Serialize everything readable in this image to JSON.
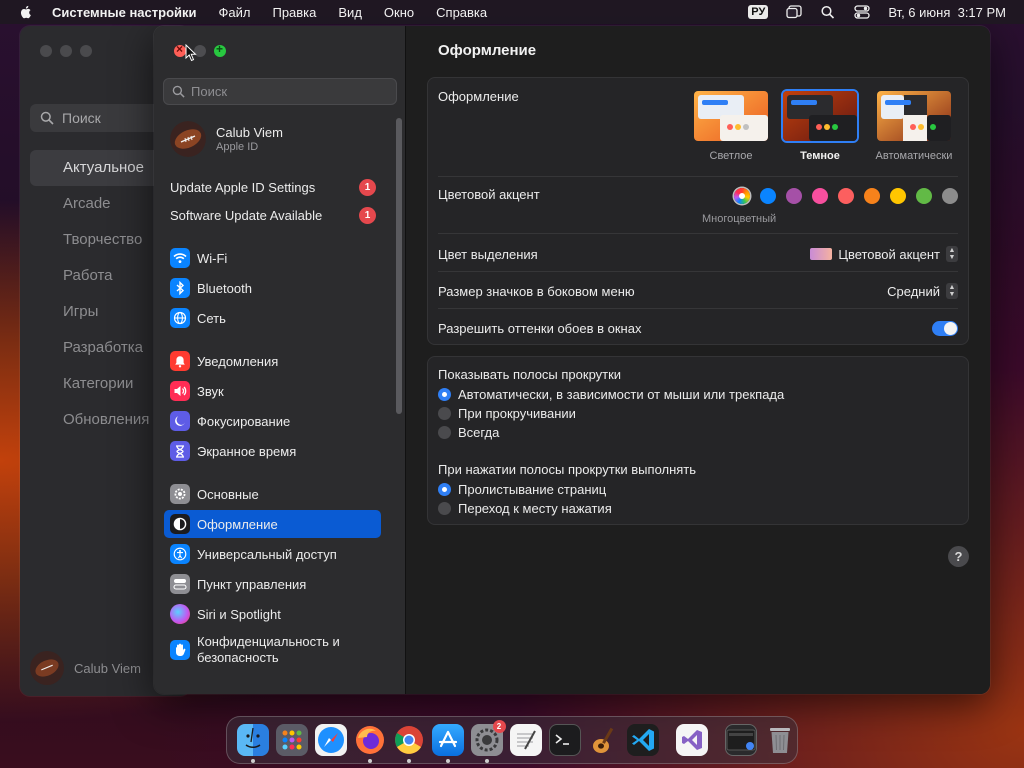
{
  "menubar": {
    "app_name": "Системные настройки",
    "menus": [
      "Файл",
      "Правка",
      "Вид",
      "Окно",
      "Справка"
    ],
    "input_lang": "РУ",
    "datetime": "Вт, 6 июня  3:17 PM"
  },
  "bg_window": {
    "search_placeholder": "Поиск",
    "items": [
      "Актуальное",
      "Arcade",
      "Творчество",
      "Работа",
      "Игры",
      "Разработка",
      "Категории",
      "Обновления"
    ],
    "user_name": "Calub Viem"
  },
  "sidebar": {
    "search_placeholder": "Поиск",
    "profile": {
      "name": "Calub Viem",
      "sub": "Apple ID"
    },
    "notices": [
      {
        "label": "Update Apple ID Settings",
        "badge": "1"
      },
      {
        "label": "Software Update Available",
        "badge": "1"
      }
    ],
    "items": [
      {
        "label": "Wi-Fi",
        "icon": "wifi-icon",
        "color": "#0a84ff"
      },
      {
        "label": "Bluetooth",
        "icon": "bluetooth-icon",
        "color": "#0a84ff"
      },
      {
        "label": "Сеть",
        "icon": "globe-icon",
        "color": "#0a84ff"
      },
      {
        "label": "Уведомления",
        "icon": "bell-icon",
        "color": "#ff3b30"
      },
      {
        "label": "Звук",
        "icon": "speaker-icon",
        "color": "#ff2d55"
      },
      {
        "label": "Фокусирование",
        "icon": "moon-icon",
        "color": "#5e5ce6"
      },
      {
        "label": "Экранное время",
        "icon": "hourglass-icon",
        "color": "#5e5ce6"
      },
      {
        "label": "Основные",
        "icon": "gear-icon",
        "color": "#8e8e93"
      },
      {
        "label": "Оформление",
        "icon": "appearance-icon",
        "color": "#1c1c1e"
      },
      {
        "label": "Универсальный доступ",
        "icon": "accessibility-icon",
        "color": "#0a84ff"
      },
      {
        "label": "Пункт управления",
        "icon": "control-center-icon",
        "color": "#8e8e93"
      },
      {
        "label": "Siri и Spotlight",
        "icon": "siri-icon",
        "color": "#bf5af2"
      },
      {
        "label": "Конфиденциальность и безопасность",
        "icon": "hand-icon",
        "color": "#0a84ff"
      }
    ]
  },
  "content": {
    "title": "Оформление",
    "appearance": {
      "label": "Оформление",
      "options": [
        {
          "label": "Светлое",
          "selected": false
        },
        {
          "label": "Темное",
          "selected": true
        },
        {
          "label": "Автоматически",
          "selected": false
        }
      ]
    },
    "accent": {
      "label": "Цветовой акцент",
      "selected_name": "Многоцветный",
      "colors": [
        "multicolor",
        "#0a84ff",
        "#a550a7",
        "#f74f9e",
        "#fc5f5f",
        "#f7821b",
        "#ffc600",
        "#62ba46",
        "#8c8c8c"
      ]
    },
    "highlight": {
      "label": "Цвет выделения",
      "value": "Цветовой акцент"
    },
    "sidebar_icon_size": {
      "label": "Размер значков в боковом меню",
      "value": "Средний"
    },
    "wallpaper_tinting": {
      "label": "Разрешить оттенки обоев в окнах",
      "on": true
    },
    "scrollbars": {
      "label": "Показывать полосы прокрутки",
      "options": [
        {
          "label": "Автоматически, в зависимости от мыши или трекпада",
          "selected": true
        },
        {
          "label": "При прокручивании",
          "selected": false
        },
        {
          "label": "Всегда",
          "selected": false
        }
      ]
    },
    "scroll_click": {
      "label": "При нажатии полосы прокрутки выполнять",
      "options": [
        {
          "label": "Пролистывание страниц",
          "selected": true
        },
        {
          "label": "Переход к месту нажатия",
          "selected": false
        }
      ]
    },
    "help": "?"
  },
  "dock": {
    "apps": [
      "finder-icon",
      "launchpad-icon",
      "safari-icon",
      "firefox-icon",
      "chrome-icon",
      "app-store-icon",
      "system-settings-icon",
      "textedit-icon",
      "terminal-icon",
      "garageband-icon",
      "vscode-icon",
      "visual-studio-icon"
    ],
    "settings_badge": "2"
  }
}
